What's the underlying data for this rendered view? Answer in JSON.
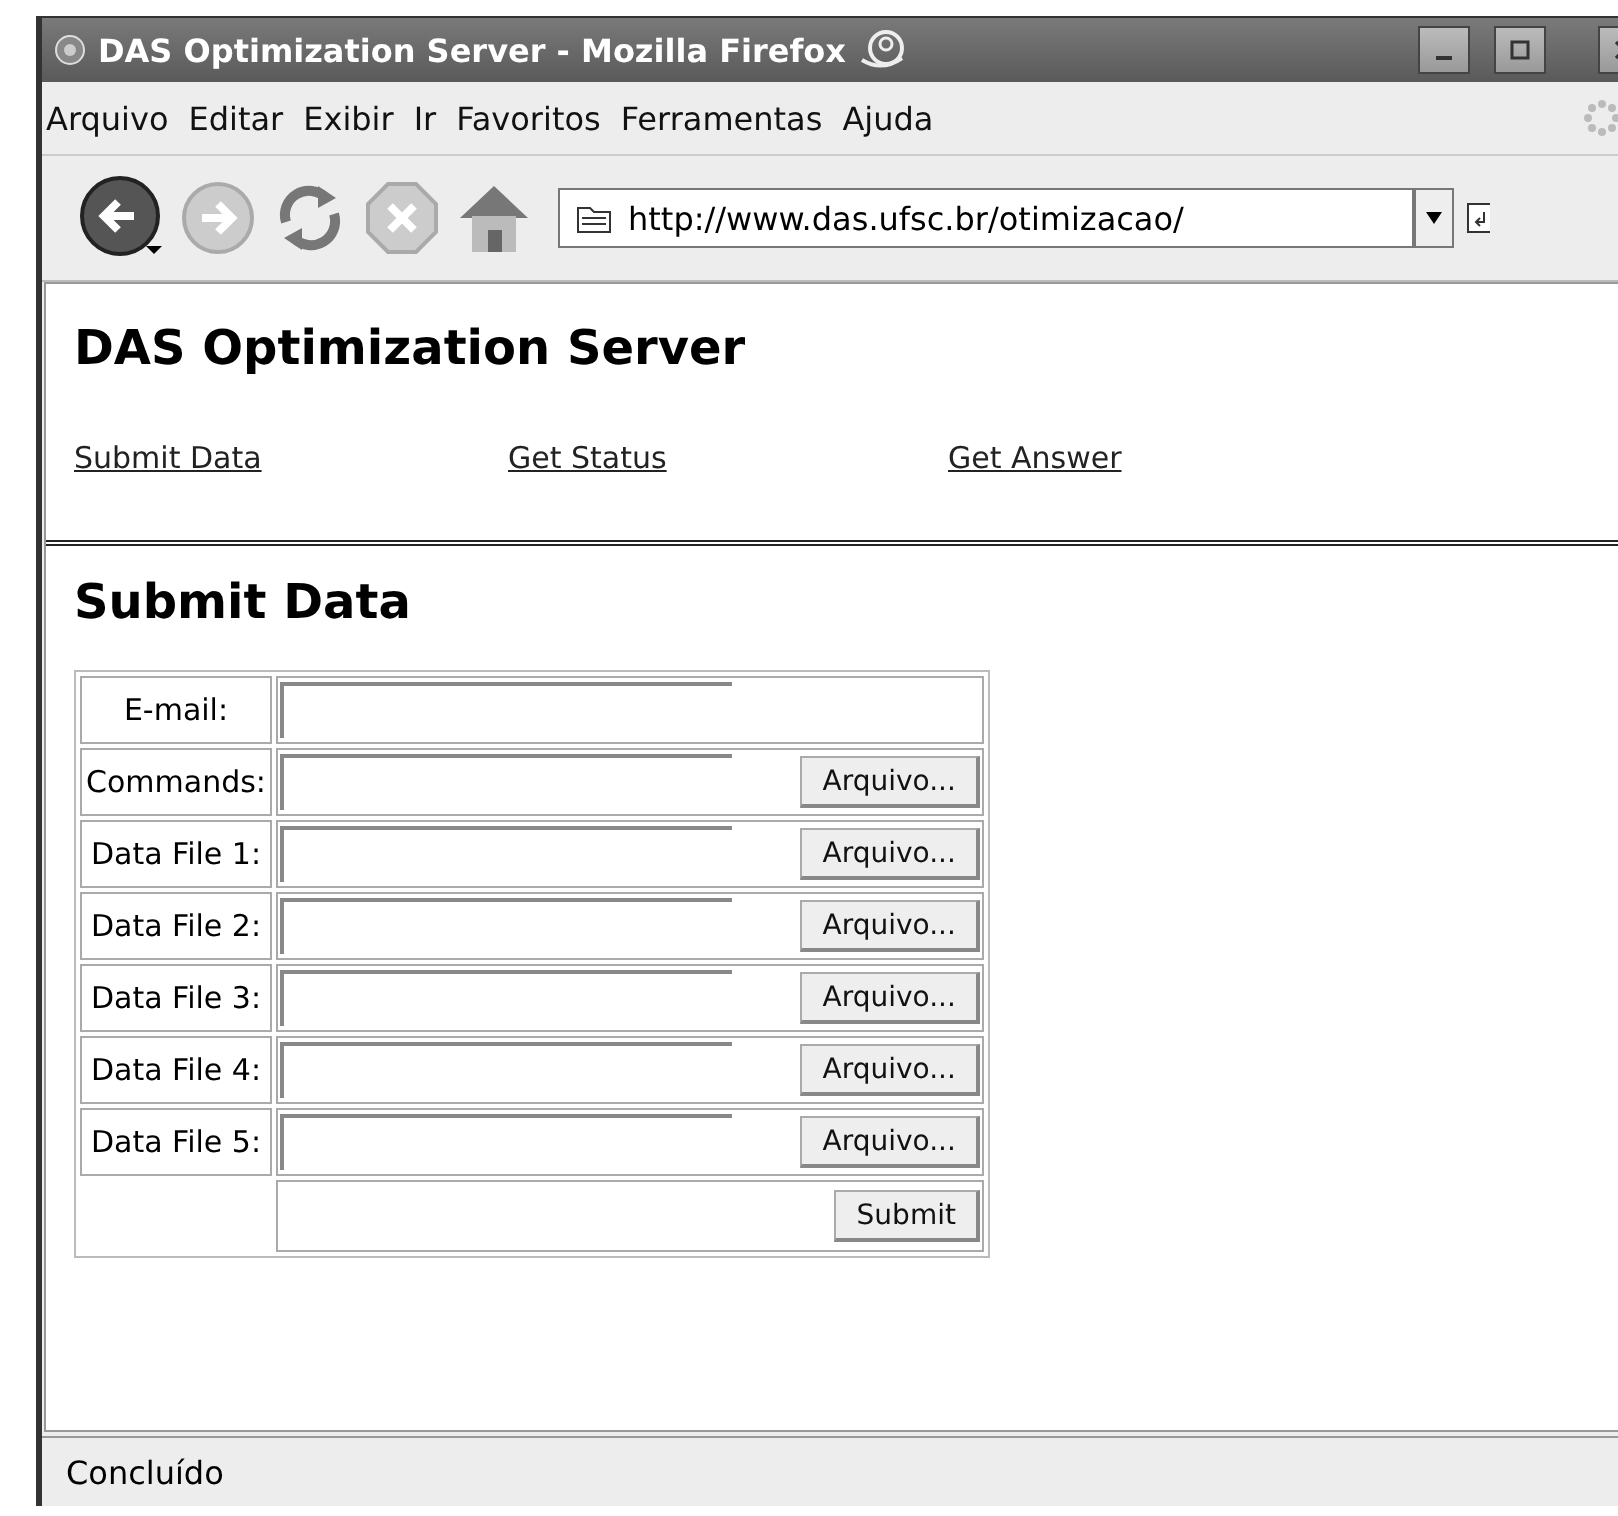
{
  "window": {
    "title": "DAS Optimization Server - Mozilla Firefox"
  },
  "menu": [
    "Arquivo",
    "Editar",
    "Exibir",
    "Ir",
    "Favoritos",
    "Ferramentas",
    "Ajuda"
  ],
  "toolbar": {
    "address": "http://www.das.ufsc.br/otimizacao/"
  },
  "page": {
    "heading": "DAS Optimization Server",
    "links": [
      "Submit Data",
      "Get Status",
      "Get Answer"
    ],
    "section_heading": "Submit Data",
    "form": [
      {
        "kind": "text",
        "label": "E-mail:"
      },
      {
        "kind": "file",
        "label": "Commands:",
        "button": "Arquivo..."
      },
      {
        "kind": "file",
        "label": "Data File 1:",
        "button": "Arquivo..."
      },
      {
        "kind": "file",
        "label": "Data File 2:",
        "button": "Arquivo..."
      },
      {
        "kind": "file",
        "label": "Data File 3:",
        "button": "Arquivo..."
      },
      {
        "kind": "file",
        "label": "Data File 4:",
        "button": "Arquivo..."
      },
      {
        "kind": "file",
        "label": "Data File 5:",
        "button": "Arquivo..."
      }
    ],
    "submit": "Submit"
  },
  "status_bar": "Concluído"
}
